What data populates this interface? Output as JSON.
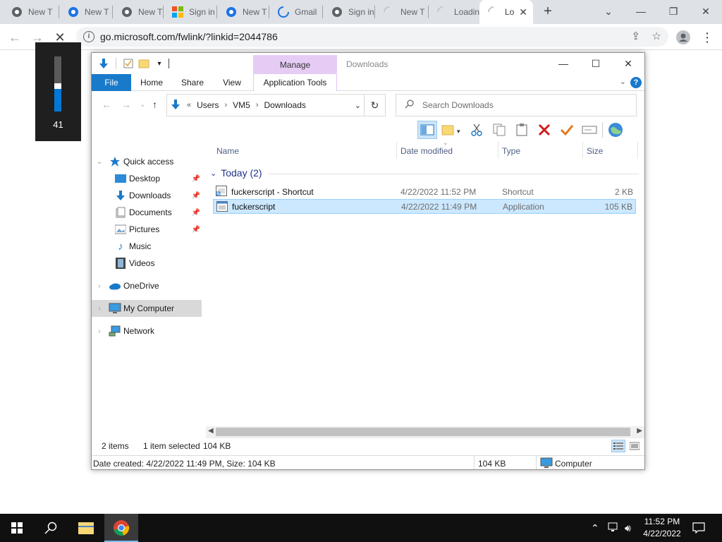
{
  "browser": {
    "tabs": [
      {
        "title": "New T",
        "favicon": "chrome-icon"
      },
      {
        "title": "New T",
        "favicon": "blue-chrome-icon"
      },
      {
        "title": "New T",
        "favicon": "chrome-icon"
      },
      {
        "title": "Sign in",
        "favicon": "microsoft-logo-icon"
      },
      {
        "title": "New T",
        "favicon": "blue-chrome-icon"
      },
      {
        "title": "Gmail",
        "favicon": "loading-spinner-icon"
      },
      {
        "title": "Sign in",
        "favicon": "chrome-icon"
      },
      {
        "title": "New T",
        "favicon": "blank-page-icon"
      },
      {
        "title": "Loadin",
        "favicon": "loading-spinner-icon"
      },
      {
        "title": "Lo",
        "favicon": "loading-spinner-icon",
        "active": true
      }
    ],
    "url": "go.microsoft.com/fwlink/?linkid=2044786"
  },
  "volume_osd": {
    "level": 41,
    "display": "41"
  },
  "explorer": {
    "window_title": "Downloads",
    "manage_label": "Manage",
    "ribbon_tabs": {
      "file": "File",
      "home": "Home",
      "share": "Share",
      "view": "View",
      "tools": "Application Tools"
    },
    "breadcrumb": {
      "overflow": "«",
      "items": [
        "Users",
        "VM5",
        "Downloads"
      ]
    },
    "search_placeholder": "Search Downloads",
    "nav": {
      "quick_access": "Quick access",
      "desktop": "Desktop",
      "downloads": "Downloads",
      "documents": "Documents",
      "pictures": "Pictures",
      "music": "Music",
      "videos": "Videos",
      "onedrive": "OneDrive",
      "my_computer": "My Computer",
      "network": "Network"
    },
    "columns": {
      "name": "Name",
      "date": "Date modified",
      "type": "Type",
      "size": "Size"
    },
    "group": "Today (2)",
    "files": [
      {
        "name": "fuckerscript - Shortcut",
        "date": "4/22/2022 11:52 PM",
        "type": "Shortcut",
        "size": "2 KB",
        "selected": false
      },
      {
        "name": "fuckerscript",
        "date": "4/22/2022 11:49 PM",
        "type": "Application",
        "size": "105 KB",
        "selected": true
      }
    ],
    "status": {
      "items": "2 items",
      "selected": "1 item selected",
      "size": "104 KB"
    },
    "details": {
      "created": "Date created: 4/22/2022 11:49 PM, Size: 104 KB",
      "size": "104 KB",
      "location": "Computer"
    }
  },
  "taskbar": {
    "time": "11:52 PM",
    "date": "4/22/2022"
  }
}
